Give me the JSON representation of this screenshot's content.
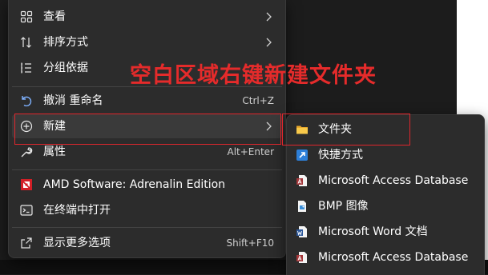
{
  "annotation": "空白区域右键新建文件夹",
  "colors": {
    "highlight_box": "#e0262d",
    "annotation_text": "#e52b2b",
    "menu_bg": "#2c2c2c"
  },
  "context_menu": {
    "items": [
      {
        "label": "查看",
        "icon": "grid-icon",
        "has_submenu": true
      },
      {
        "label": "排序方式",
        "icon": "sort-icon",
        "has_submenu": true
      },
      {
        "label": "分组依据",
        "icon": "group-list-icon"
      },
      {
        "label": "撤消 重命名",
        "icon": "undo-icon",
        "shortcut": "Ctrl+Z"
      },
      {
        "label": "新建",
        "icon": "add-circle-icon",
        "has_submenu": true
      },
      {
        "label": "属性",
        "icon": "wrench-icon",
        "shortcut": "Alt+Enter"
      },
      {
        "label": "AMD Software: Adrenalin Edition",
        "icon": "amd-logo-icon"
      },
      {
        "label": "在终端中打开",
        "icon": "terminal-icon"
      },
      {
        "label": "显示更多选项",
        "icon": "external-open-icon",
        "shortcut": "Shift+F10"
      }
    ]
  },
  "new_submenu": {
    "items": [
      {
        "label": "文件夹",
        "icon": "folder-icon"
      },
      {
        "label": "快捷方式",
        "icon": "shortcut-icon"
      },
      {
        "label": "Microsoft Access Database",
        "icon": "access-file-icon"
      },
      {
        "label": "BMP 图像",
        "icon": "bmp-file-icon"
      },
      {
        "label": "Microsoft Word 文档",
        "icon": "word-file-icon"
      },
      {
        "label": "Microsoft Access Database",
        "icon": "access-file-icon"
      }
    ]
  }
}
